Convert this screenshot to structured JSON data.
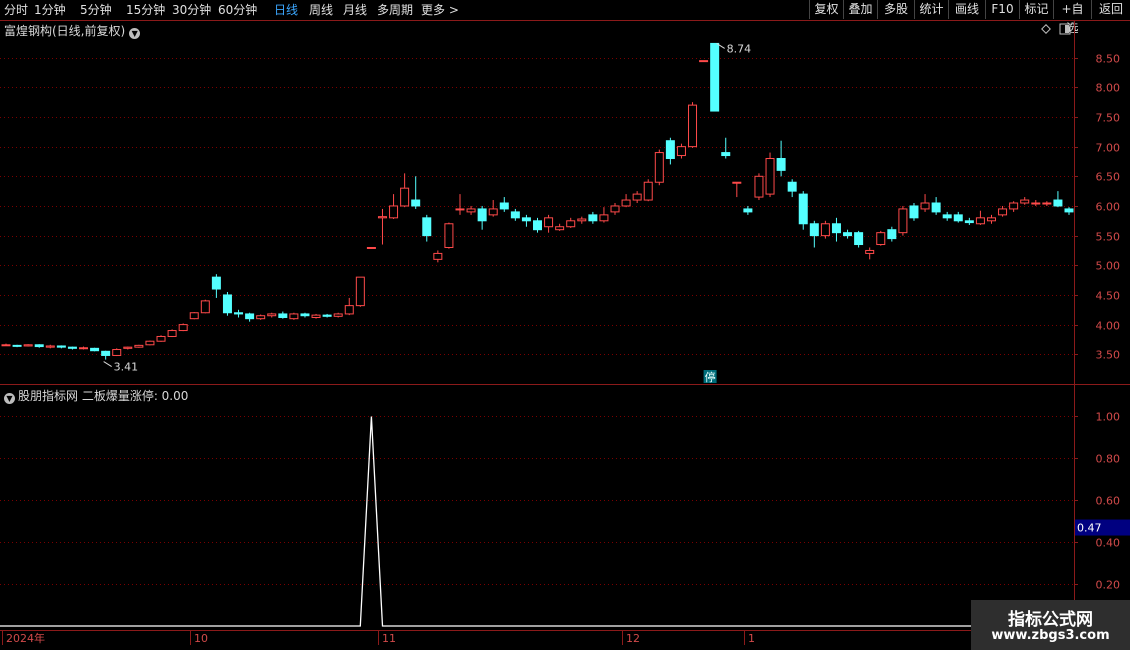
{
  "toolbar": {
    "periods": [
      "分时",
      "1分钟",
      "5分钟",
      "15分钟",
      "30分钟",
      "60分钟",
      "日线",
      "周线",
      "月线",
      "多周期",
      "更多 >"
    ],
    "active": "日线",
    "right_buttons": [
      "复权",
      "叠加",
      "多股",
      "统计",
      "画线",
      "F10",
      "标记",
      "+自选",
      "返回"
    ]
  },
  "main_title": "富煌钢构(日线,前复权)",
  "indicator_title": "股朋指标网 二板爆量涨停: 0.00",
  "stop_marker": "停",
  "colors": {
    "up": "#ff4a4a",
    "down": "#54ffff",
    "grid": "#7a0000",
    "frame": "#8b1a1a",
    "axis_text": "#d24a4a",
    "indicator_line": "#ffffff",
    "highlight": "#000080"
  },
  "watermark": {
    "title": "指标公式网",
    "url": "www.zbgs3.com"
  },
  "chart_data": [
    {
      "type": "candlestick",
      "title": "富煌钢构(日线,前复权)",
      "ylim": [
        3.1,
        9.0
      ],
      "y_ticks": [
        "8.50",
        "8.00",
        "7.50",
        "7.00",
        "6.50",
        "6.00",
        "5.50",
        "5.00",
        "4.50",
        "4.00",
        "3.50"
      ],
      "x_ticks": [
        "2024年",
        "10",
        "11",
        "12",
        "1"
      ],
      "annotations": [
        {
          "text": "3.41",
          "value": 3.41
        },
        {
          "text": "8.74",
          "value": 8.74
        }
      ],
      "candles": [
        [
          3.65,
          3.66,
          3.68,
          3.64
        ],
        [
          3.65,
          3.64,
          3.66,
          3.62
        ],
        [
          3.64,
          3.66,
          3.67,
          3.63
        ],
        [
          3.66,
          3.63,
          3.67,
          3.61
        ],
        [
          3.62,
          3.64,
          3.66,
          3.6
        ],
        [
          3.64,
          3.62,
          3.65,
          3.6
        ],
        [
          3.62,
          3.6,
          3.63,
          3.58
        ],
        [
          3.6,
          3.61,
          3.63,
          3.58
        ],
        [
          3.6,
          3.56,
          3.61,
          3.55
        ],
        [
          3.55,
          3.48,
          3.56,
          3.41
        ],
        [
          3.48,
          3.58,
          3.6,
          3.47
        ],
        [
          3.6,
          3.62,
          3.63,
          3.58
        ],
        [
          3.62,
          3.65,
          3.66,
          3.61
        ],
        [
          3.66,
          3.72,
          3.73,
          3.65
        ],
        [
          3.72,
          3.8,
          3.82,
          3.71
        ],
        [
          3.8,
          3.9,
          3.92,
          3.79
        ],
        [
          3.9,
          4.0,
          4.02,
          3.89
        ],
        [
          4.1,
          4.2,
          4.21,
          4.09
        ],
        [
          4.2,
          4.4,
          4.42,
          4.19
        ],
        [
          4.8,
          4.6,
          4.85,
          4.45
        ],
        [
          4.5,
          4.2,
          4.55,
          4.15
        ],
        [
          4.2,
          4.18,
          4.25,
          4.12
        ],
        [
          4.18,
          4.1,
          4.2,
          4.05
        ],
        [
          4.1,
          4.15,
          4.17,
          4.08
        ],
        [
          4.15,
          4.18,
          4.2,
          4.12
        ],
        [
          4.18,
          4.12,
          4.22,
          4.1
        ],
        [
          4.1,
          4.18,
          4.2,
          4.08
        ],
        [
          4.18,
          4.15,
          4.2,
          4.12
        ],
        [
          4.12,
          4.16,
          4.18,
          4.1
        ],
        [
          4.16,
          4.14,
          4.18,
          4.12
        ],
        [
          4.14,
          4.18,
          4.2,
          4.12
        ],
        [
          4.18,
          4.32,
          4.45,
          4.16
        ],
        [
          4.32,
          4.8,
          4.8,
          4.3
        ],
        [
          5.3,
          5.3,
          5.3,
          5.3
        ],
        [
          5.8,
          5.82,
          5.95,
          5.35
        ],
        [
          5.8,
          6.0,
          6.2,
          5.78
        ],
        [
          6.0,
          6.3,
          6.55,
          5.98
        ],
        [
          6.1,
          6.0,
          6.5,
          5.95
        ],
        [
          5.8,
          5.5,
          5.85,
          5.4
        ],
        [
          5.1,
          5.2,
          5.25,
          5.05
        ],
        [
          5.3,
          5.7,
          5.72,
          5.28
        ],
        [
          5.95,
          5.95,
          6.2,
          5.85
        ],
        [
          5.9,
          5.95,
          6.0,
          5.85
        ],
        [
          5.95,
          5.75,
          6.0,
          5.6
        ],
        [
          5.85,
          5.95,
          6.1,
          5.82
        ],
        [
          6.05,
          5.95,
          6.15,
          5.9
        ],
        [
          5.9,
          5.8,
          5.95,
          5.75
        ],
        [
          5.8,
          5.75,
          5.85,
          5.65
        ],
        [
          5.75,
          5.6,
          5.8,
          5.55
        ],
        [
          5.65,
          5.8,
          5.85,
          5.55
        ],
        [
          5.6,
          5.65,
          5.7,
          5.58
        ],
        [
          5.65,
          5.75,
          5.8,
          5.63
        ],
        [
          5.75,
          5.78,
          5.82,
          5.7
        ],
        [
          5.85,
          5.75,
          5.9,
          5.7
        ],
        [
          5.75,
          5.85,
          5.98,
          5.72
        ],
        [
          5.9,
          6.0,
          6.05,
          5.85
        ],
        [
          6.0,
          6.1,
          6.2,
          5.98
        ],
        [
          6.1,
          6.2,
          6.25,
          6.05
        ],
        [
          6.1,
          6.4,
          6.45,
          6.08
        ],
        [
          6.4,
          6.9,
          6.95,
          6.35
        ],
        [
          7.1,
          6.8,
          7.15,
          6.7
        ],
        [
          6.85,
          7.0,
          7.05,
          6.8
        ],
        [
          7.0,
          7.7,
          7.75,
          6.98
        ],
        [
          8.45,
          8.45,
          8.45,
          8.45
        ],
        [
          8.74,
          7.6,
          8.74,
          7.6
        ],
        [
          6.9,
          6.85,
          7.15,
          6.8
        ],
        [
          6.4,
          6.4,
          6.4,
          6.15
        ],
        [
          5.95,
          5.9,
          6.0,
          5.85
        ],
        [
          6.15,
          6.5,
          6.55,
          6.1
        ],
        [
          6.2,
          6.8,
          6.9,
          6.15
        ],
        [
          6.8,
          6.6,
          7.1,
          6.5
        ],
        [
          6.4,
          6.25,
          6.45,
          6.15
        ],
        [
          6.2,
          5.7,
          6.25,
          5.6
        ],
        [
          5.7,
          5.5,
          5.75,
          5.3
        ],
        [
          5.5,
          5.7,
          5.75,
          5.45
        ],
        [
          5.7,
          5.55,
          5.8,
          5.4
        ],
        [
          5.55,
          5.5,
          5.6,
          5.45
        ],
        [
          5.55,
          5.35,
          5.58,
          5.3
        ],
        [
          5.2,
          5.25,
          5.3,
          5.1
        ],
        [
          5.35,
          5.55,
          5.58,
          5.33
        ],
        [
          5.6,
          5.45,
          5.65,
          5.4
        ],
        [
          5.55,
          5.95,
          6.0,
          5.5
        ],
        [
          6.0,
          5.8,
          6.05,
          5.75
        ],
        [
          5.95,
          6.05,
          6.2,
          5.9
        ],
        [
          6.05,
          5.9,
          6.15,
          5.85
        ],
        [
          5.85,
          5.8,
          5.9,
          5.75
        ],
        [
          5.85,
          5.75,
          5.9,
          5.72
        ],
        [
          5.75,
          5.72,
          5.8,
          5.68
        ],
        [
          5.7,
          5.8,
          5.92,
          5.68
        ],
        [
          5.75,
          5.8,
          5.85,
          5.7
        ],
        [
          5.85,
          5.95,
          6.0,
          5.82
        ],
        [
          5.95,
          6.05,
          6.08,
          5.9
        ],
        [
          6.05,
          6.1,
          6.15,
          6.02
        ],
        [
          6.05,
          6.05,
          6.1,
          6.0
        ],
        [
          6.05,
          6.05,
          6.08,
          6.0
        ],
        [
          6.1,
          6.0,
          6.25,
          5.98
        ],
        [
          5.95,
          5.9,
          5.98,
          5.85
        ]
      ]
    },
    {
      "type": "line",
      "series": [
        {
          "name": "二板爆量涨停",
          "values": [
            0,
            0,
            0,
            0,
            0,
            0,
            0,
            0,
            0,
            0,
            0,
            0,
            0,
            0,
            0,
            0,
            0,
            0,
            0,
            0,
            0,
            0,
            0,
            0,
            0,
            0,
            0,
            0,
            0,
            0,
            0,
            0,
            0,
            1,
            0,
            0,
            0,
            0,
            0,
            0,
            0,
            0,
            0,
            0,
            0,
            0,
            0,
            0,
            0,
            0,
            0,
            0,
            0,
            0,
            0,
            0,
            0,
            0,
            0,
            0,
            0,
            0,
            0,
            0,
            0,
            0,
            0,
            0,
            0,
            0,
            0,
            0,
            0,
            0,
            0,
            0,
            0,
            0,
            0,
            0,
            0,
            0,
            0,
            0,
            0,
            0,
            0,
            0,
            0,
            0,
            0,
            0,
            0,
            0,
            0,
            0,
            0
          ]
        }
      ],
      "ylim": [
        0,
        1.05
      ],
      "y_ticks": [
        "1.00",
        "0.80",
        "0.60",
        "0.40",
        "0.20"
      ],
      "highlight_label": "0.47",
      "highlight_value": 0.47
    }
  ]
}
